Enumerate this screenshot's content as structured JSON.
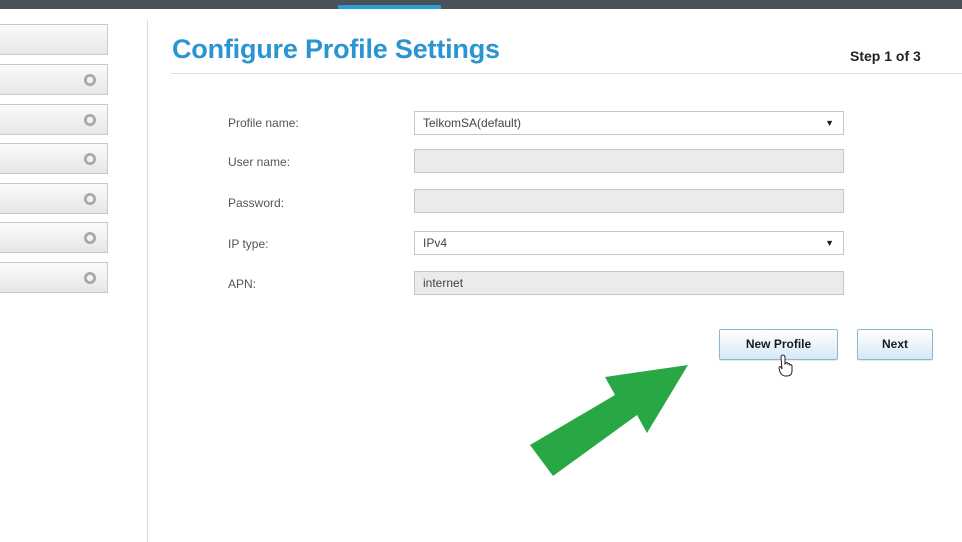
{
  "header": {
    "title": "Configure Profile Settings",
    "step": "Step 1 of 3"
  },
  "sidebar": {
    "items": [
      {
        "label": "",
        "icon": "none"
      },
      {
        "label": "",
        "icon": "circle-icon"
      },
      {
        "label": "",
        "icon": "circle-icon"
      },
      {
        "label": "",
        "icon": "circle-icon"
      },
      {
        "label": "",
        "icon": "circle-icon"
      },
      {
        "label": "",
        "icon": "circle-icon"
      },
      {
        "label": "",
        "icon": "circle-icon"
      }
    ]
  },
  "form": {
    "profile_name": {
      "label": "Profile name:",
      "value": "TelkomSA(default)"
    },
    "user_name": {
      "label": "User name:",
      "value": ""
    },
    "password": {
      "label": "Password:",
      "value": ""
    },
    "ip_type": {
      "label": "IP type:",
      "value": "IPv4"
    },
    "apn": {
      "label": "APN:",
      "value": "internet"
    }
  },
  "buttons": {
    "new_profile": "New Profile",
    "next": "Next"
  },
  "icons": {
    "dropdown_caret": "▼"
  },
  "colors": {
    "title": "#2a95d1",
    "accent_bar": "#2a9fd6",
    "arrow": "#27a844"
  }
}
